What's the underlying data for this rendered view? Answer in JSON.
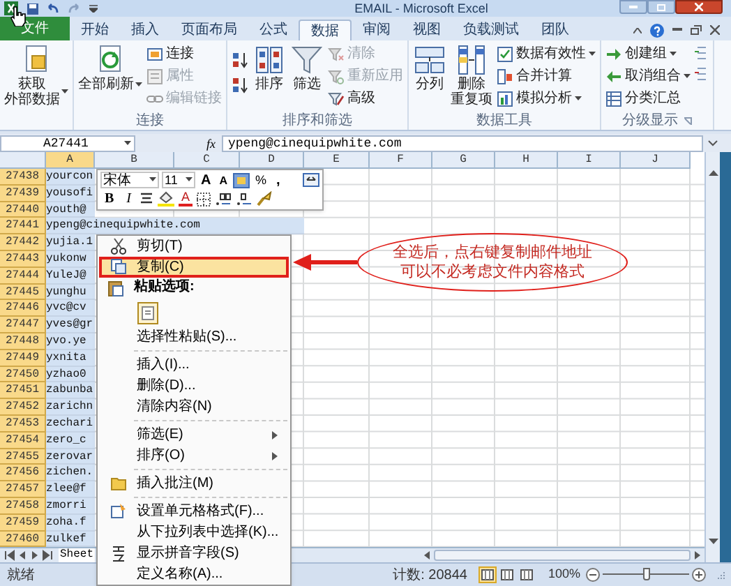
{
  "window": {
    "title": "EMAIL - Microsoft Excel"
  },
  "tabs": [
    {
      "label": "文件",
      "selected": false,
      "kind": "file"
    },
    {
      "label": "开始",
      "selected": false,
      "kind": "tab"
    },
    {
      "label": "插入",
      "selected": false,
      "kind": "tab"
    },
    {
      "label": "页面布局",
      "selected": false,
      "kind": "tab"
    },
    {
      "label": "公式",
      "selected": false,
      "kind": "tab"
    },
    {
      "label": "数据",
      "selected": true,
      "kind": "tab"
    },
    {
      "label": "审阅",
      "selected": false,
      "kind": "tab"
    },
    {
      "label": "视图",
      "selected": false,
      "kind": "tab"
    },
    {
      "label": "负载测试",
      "selected": false,
      "kind": "tab"
    },
    {
      "label": "团队",
      "selected": false,
      "kind": "tab"
    }
  ],
  "ribbon": {
    "groups": [
      {
        "items": [
          {
            "kind": "large",
            "lines": [
              "获取",
              "外部数据"
            ],
            "dropdown": true,
            "disabled": false
          }
        ]
      },
      {
        "title": "连接",
        "items": [
          {
            "kind": "large",
            "lines": [
              "全部刷新"
            ],
            "dropdown": true,
            "disabled": false
          },
          {
            "kind": "small",
            "label": "连接",
            "dropdown": false,
            "disabled": false
          },
          {
            "kind": "small",
            "label": "属性",
            "dropdown": false,
            "disabled": true
          },
          {
            "kind": "small",
            "label": "编辑链接",
            "dropdown": false,
            "disabled": true
          }
        ]
      },
      {
        "title": "排序和筛选",
        "items": [
          {
            "kind": "sort-pair"
          },
          {
            "kind": "large",
            "lines": [
              "排序"
            ],
            "dropdown": false,
            "disabled": false
          },
          {
            "kind": "large",
            "lines": [
              "筛选"
            ],
            "dropdown": false,
            "disabled": false
          },
          {
            "kind": "small",
            "label": "清除",
            "dropdown": false,
            "disabled": true
          },
          {
            "kind": "small",
            "label": "重新应用",
            "dropdown": false,
            "disabled": true
          },
          {
            "kind": "small",
            "label": "高级",
            "dropdown": false,
            "disabled": false
          }
        ]
      },
      {
        "title": "数据工具",
        "items": [
          {
            "kind": "large",
            "lines": [
              "分列"
            ],
            "dropdown": false,
            "disabled": false
          },
          {
            "kind": "large",
            "lines": [
              "删除",
              "重复项"
            ],
            "dropdown": false,
            "disabled": false
          },
          {
            "kind": "small",
            "label": "数据有效性",
            "dropdown": true,
            "disabled": false
          },
          {
            "kind": "small",
            "label": "合并计算",
            "dropdown": false,
            "disabled": false
          },
          {
            "kind": "small",
            "label": "模拟分析",
            "dropdown": true,
            "disabled": false
          }
        ]
      },
      {
        "title": "分级显示",
        "items": [
          {
            "kind": "small",
            "label": "创建组",
            "dropdown": true,
            "disabled": false
          },
          {
            "kind": "small",
            "label": "取消组合",
            "dropdown": true,
            "disabled": false
          },
          {
            "kind": "small",
            "label": "分类汇总",
            "dropdown": false,
            "disabled": false
          },
          {
            "kind": "detail-pair"
          }
        ]
      }
    ]
  },
  "formula_bar": {
    "name_box": "A27441",
    "fx": "fx",
    "value": "ypeng@cinequipwhite.com"
  },
  "sheet": {
    "columns": [
      {
        "label": "A",
        "selected": true
      },
      {
        "label": "B",
        "selected": false
      },
      {
        "label": "C",
        "selected": false
      },
      {
        "label": "D",
        "selected": false
      },
      {
        "label": "E",
        "selected": false
      },
      {
        "label": "F",
        "selected": false
      },
      {
        "label": "G",
        "selected": false
      },
      {
        "label": "H",
        "selected": false
      },
      {
        "label": "I",
        "selected": false
      },
      {
        "label": "J",
        "selected": false
      }
    ],
    "rows": [
      {
        "number": "27438",
        "value": "yourcon",
        "selected": true
      },
      {
        "number": "27439",
        "value": "yousofi",
        "selected": true
      },
      {
        "number": "27440",
        "value": "youth@",
        "selected": true
      },
      {
        "number": "27441",
        "value": "ypeng@cinequipwhite.com",
        "selected": true
      },
      {
        "number": "27442",
        "value": "yujia.1",
        "selected": true
      },
      {
        "number": "27443",
        "value": "yukonw",
        "selected": true
      },
      {
        "number": "27444",
        "value": "YuleJ@",
        "selected": true
      },
      {
        "number": "27445",
        "value": "yunghu",
        "selected": true
      },
      {
        "number": "27446",
        "value": "yvc@cv",
        "selected": true
      },
      {
        "number": "27447",
        "value": "yves@gr",
        "selected": true
      },
      {
        "number": "27448",
        "value": "yvo.ye",
        "selected": true
      },
      {
        "number": "27449",
        "value": "yxnita",
        "selected": true
      },
      {
        "number": "27450",
        "value": "yzhao0",
        "selected": true
      },
      {
        "number": "27451",
        "value": "zabunba",
        "selected": true
      },
      {
        "number": "27452",
        "value": "zarichn",
        "selected": true
      },
      {
        "number": "27453",
        "value": "zechari",
        "selected": true
      },
      {
        "number": "27454",
        "value": "zero_c",
        "selected": true
      },
      {
        "number": "27455",
        "value": "zerovar",
        "selected": true
      },
      {
        "number": "27456",
        "value": "zichen.",
        "selected": true
      },
      {
        "number": "27457",
        "value": "zlee@f",
        "selected": true
      },
      {
        "number": "27458",
        "value": "zmorri",
        "selected": true
      },
      {
        "number": "27459",
        "value": "zoha.f",
        "selected": true
      },
      {
        "number": "27460",
        "value": "zulkef",
        "selected": true
      }
    ]
  },
  "sheet_tabs": [
    {
      "label": "Sheet",
      "selected": true
    }
  ],
  "mini_toolbar": {
    "font": "宋体",
    "size": "11",
    "row1": [
      {
        "kind": "grow-font",
        "text": "A"
      },
      {
        "kind": "shrink-font",
        "text": "A"
      },
      {
        "kind": "cell-styles"
      },
      {
        "kind": "percent",
        "text": "%"
      },
      {
        "kind": "comma",
        "text": ","
      },
      {
        "kind": "merge"
      }
    ],
    "row2": [
      {
        "kind": "bold",
        "text": "B"
      },
      {
        "kind": "italic",
        "text": "I"
      },
      {
        "kind": "center"
      },
      {
        "kind": "fill-color"
      },
      {
        "kind": "font-color",
        "text": "A"
      },
      {
        "kind": "borders"
      },
      {
        "kind": "increase-decimal"
      },
      {
        "kind": "decrease-decimal"
      },
      {
        "kind": "format-painter"
      }
    ]
  },
  "context_menu": {
    "items": [
      {
        "kind": "item",
        "label": "剪切(T)",
        "selected": false,
        "submenu": false
      },
      {
        "kind": "item",
        "label": "复制(C)",
        "selected": true,
        "submenu": false
      },
      {
        "kind": "heading",
        "label": "粘贴选项:"
      },
      {
        "kind": "paste-options"
      },
      {
        "kind": "item",
        "label": "选择性粘贴(S)...",
        "selected": false,
        "submenu": false
      },
      {
        "kind": "separator"
      },
      {
        "kind": "item",
        "label": "插入(I)...",
        "selected": false,
        "submenu": false
      },
      {
        "kind": "item",
        "label": "删除(D)...",
        "selected": false,
        "submenu": false
      },
      {
        "kind": "item",
        "label": "清除内容(N)",
        "selected": false,
        "submenu": false
      },
      {
        "kind": "separator"
      },
      {
        "kind": "item",
        "label": "筛选(E)",
        "selected": false,
        "submenu": true
      },
      {
        "kind": "item",
        "label": "排序(O)",
        "selected": false,
        "submenu": true
      },
      {
        "kind": "separator"
      },
      {
        "kind": "item",
        "label": "插入批注(M)",
        "selected": false,
        "submenu": false
      },
      {
        "kind": "separator"
      },
      {
        "kind": "item",
        "label": "设置单元格格式(F)...",
        "selected": false,
        "submenu": false
      },
      {
        "kind": "item",
        "label": "从下拉列表中选择(K)...",
        "selected": false,
        "submenu": false
      },
      {
        "kind": "item",
        "label": "显示拼音字段(S)",
        "selected": false,
        "submenu": false
      },
      {
        "kind": "item",
        "label": "定义名称(A)...",
        "selected": false,
        "submenu": false
      }
    ]
  },
  "callout": {
    "lines": [
      "全选后，点右键复制邮件地址",
      "可以不必考虑文件内容格式"
    ]
  },
  "status_bar": {
    "ready": "就绪",
    "count": "计数: 20844",
    "views": [
      {
        "selected": true
      },
      {
        "selected": false
      },
      {
        "selected": false
      }
    ],
    "zoom": "100%",
    "zoom_slider": {
      "level": 0.5
    }
  }
}
